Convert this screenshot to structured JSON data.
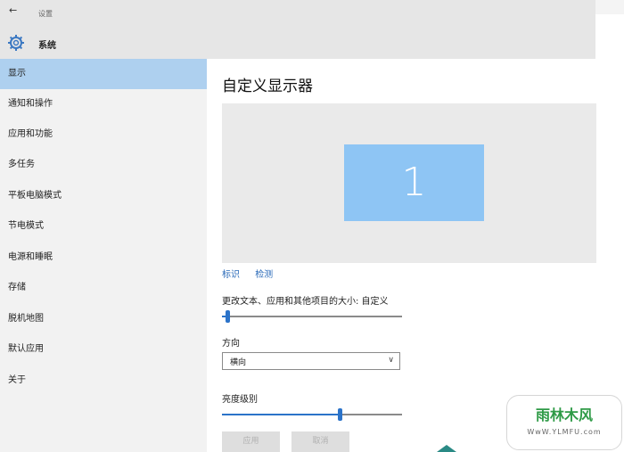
{
  "titlebar": {
    "back_symbol": "←",
    "breadcrumb": "设置",
    "system_icon": "gear-icon",
    "system_label": "系统"
  },
  "sidebar": {
    "items": [
      {
        "label": "显示",
        "active": true
      },
      {
        "label": "通知和操作"
      },
      {
        "label": "应用和功能"
      },
      {
        "label": "多任务"
      },
      {
        "label": "平板电脑模式"
      },
      {
        "label": "节电模式"
      },
      {
        "label": "电源和睡眠"
      },
      {
        "label": "存储"
      },
      {
        "label": "脱机地图"
      },
      {
        "label": "默认应用"
      },
      {
        "label": "关于"
      }
    ]
  },
  "main": {
    "title": "自定义显示器",
    "monitor_number": "1",
    "links": {
      "identify": "标识",
      "detect": "检测"
    },
    "scale": {
      "label": "更改文本、应用和其他项目的大小: 自定义",
      "level": 0.02
    },
    "orientation": {
      "label": "方向",
      "value": "横向"
    },
    "brightness": {
      "label": "亮度级别",
      "level": 0.66
    },
    "buttons": {
      "apply": "应用",
      "cancel": "取消"
    }
  },
  "watermark": {
    "logo": "雨林木风",
    "url": "WwW.YLMFU.com"
  },
  "colors": {
    "accent": "#2b73c9",
    "active_nav": "#aed0ef",
    "monitor": "#8ec5f4",
    "link": "#2a6ab8"
  }
}
